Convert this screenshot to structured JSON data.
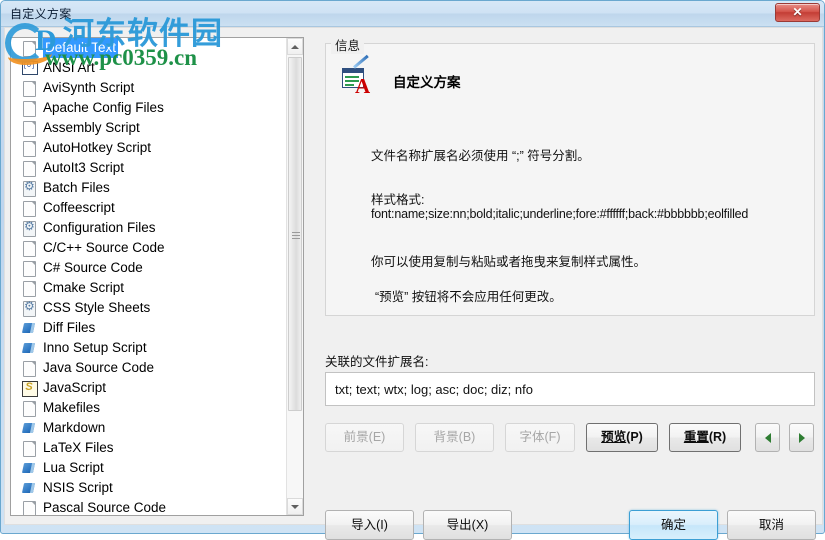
{
  "window": {
    "title": "自定义方案",
    "close_label": "✕"
  },
  "watermark": {
    "logo_letter": "D",
    "site_name_cn": "河东软件园",
    "site_url": "www.pc0359.cn"
  },
  "language_list": {
    "items": [
      {
        "label": "Default Text",
        "icon": "document-icon",
        "selected": true
      },
      {
        "label": "ANSI Art",
        "icon": "ansi-art-icon",
        "selected": false
      },
      {
        "label": "AviSynth Script",
        "icon": "document-icon",
        "selected": false
      },
      {
        "label": "Apache Config Files",
        "icon": "document-icon",
        "selected": false
      },
      {
        "label": "Assembly Script",
        "icon": "document-icon",
        "selected": false
      },
      {
        "label": "AutoHotkey Script",
        "icon": "document-icon",
        "selected": false
      },
      {
        "label": "AutoIt3 Script",
        "icon": "document-icon",
        "selected": false
      },
      {
        "label": "Batch Files",
        "icon": "gear-document-icon",
        "selected": false
      },
      {
        "label": "Coffeescript",
        "icon": "document-icon",
        "selected": false
      },
      {
        "label": "Configuration Files",
        "icon": "gear-document-icon",
        "selected": false
      },
      {
        "label": "C/C++ Source Code",
        "icon": "document-icon",
        "selected": false
      },
      {
        "label": "C# Source Code",
        "icon": "document-icon",
        "selected": false
      },
      {
        "label": "Cmake Script",
        "icon": "document-icon",
        "selected": false
      },
      {
        "label": "CSS Style Sheets",
        "icon": "gear-document-icon",
        "selected": false
      },
      {
        "label": "Diff Files",
        "icon": "blue-sheet-icon",
        "selected": false
      },
      {
        "label": "Inno Setup Script",
        "icon": "blue-sheet-icon",
        "selected": false
      },
      {
        "label": "Java Source Code",
        "icon": "document-icon",
        "selected": false
      },
      {
        "label": "JavaScript",
        "icon": "javascript-icon",
        "selected": false
      },
      {
        "label": "Makefiles",
        "icon": "document-icon",
        "selected": false
      },
      {
        "label": "Markdown",
        "icon": "blue-sheet-icon",
        "selected": false
      },
      {
        "label": "LaTeX Files",
        "icon": "document-icon",
        "selected": false
      },
      {
        "label": "Lua Script",
        "icon": "blue-sheet-icon",
        "selected": false
      },
      {
        "label": "NSIS Script",
        "icon": "blue-sheet-icon",
        "selected": false
      },
      {
        "label": "Pascal Source Code",
        "icon": "document-icon",
        "selected": false
      }
    ]
  },
  "info_group": {
    "legend": "信息",
    "scheme_title": "自定义方案",
    "line1": "文件名称扩展名必须使用 “;” 符号分割。",
    "line2": "样式格式:",
    "line3": "font:name;size:nn;bold;italic;underline;fore:#ffffff;back:#bbbbbb;eolfilled",
    "line4": "你可以使用复制与粘贴或者拖曳来复制样式属性。",
    "line5": "“预览” 按钮将不会应用任何更改。"
  },
  "extensions": {
    "label": "关联的文件扩展名:",
    "value": "txt; text; wtx; log; asc; doc; diz; nfo",
    "placeholder": ""
  },
  "style_buttons": {
    "foreground": "前景(E)",
    "background": "背景(B)",
    "font": "字体(F)",
    "preview_pre": "预览",
    "preview_suffix": "(P)",
    "reset_pre": "重置",
    "reset_suffix": "(R)",
    "prev_icon": "triangle-left-icon",
    "next_icon": "triangle-right-icon"
  },
  "dialog_buttons": {
    "import": "导入(I)",
    "export": "导出(X)",
    "ok": "确定",
    "cancel": "取消"
  },
  "colors": {
    "selection_blue": "#3399ff",
    "default_button_border": "#3c9fd4",
    "close_red": "#c33d35",
    "watermark_blue": "#2c9ad9",
    "watermark_green": "#1e9148",
    "arrow_green": "#2e7d32"
  }
}
